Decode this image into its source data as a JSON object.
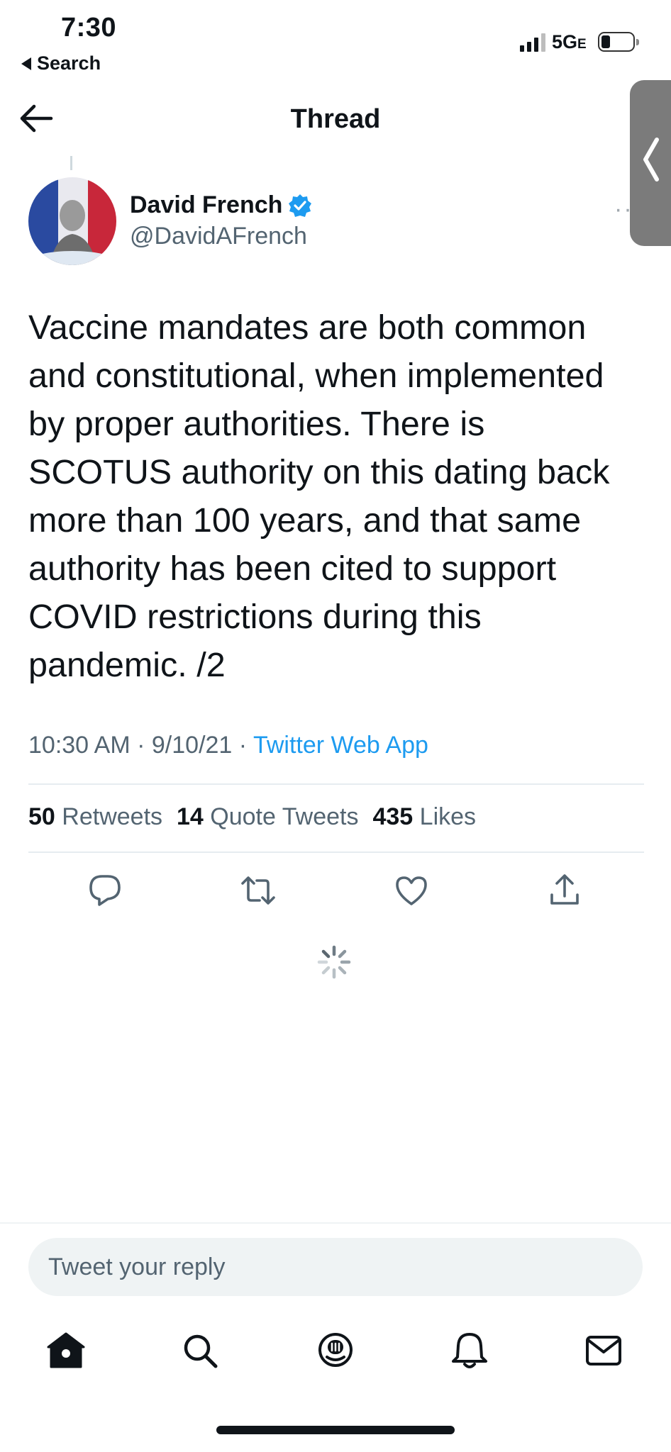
{
  "status_bar": {
    "time": "7:30",
    "back_app_label": "Search",
    "network": "5G",
    "network_suffix": "E"
  },
  "header": {
    "title": "Thread"
  },
  "tweet": {
    "author_name": "David French",
    "author_handle": "@DavidAFrench",
    "verified": true,
    "text": "Vaccine mandates are both common\nand constitutional, when implemented\nby proper authorities. There is\nSCOTUS authority on this dating back\nmore than 100 years, and that same\nauthority has been cited to support\nCOVID restrictions during this\npandemic. /2",
    "time": "10:30 AM",
    "date": "9/10/21",
    "source": "Twitter Web App",
    "stats": {
      "retweets_count": "50",
      "retweets_label": "Retweets",
      "quote_tweets_count": "14",
      "quote_tweets_label": "Quote Tweets",
      "likes_count": "435",
      "likes_label": "Likes"
    }
  },
  "reply": {
    "placeholder": "Tweet your reply"
  },
  "icons": {
    "nav": [
      "home-icon",
      "search-icon",
      "spaces-icon",
      "notifications-icon",
      "messages-icon"
    ],
    "actions": [
      "reply-icon",
      "retweet-icon",
      "like-icon",
      "share-icon"
    ]
  },
  "colors": {
    "accent": "#1d9bf0",
    "text_primary": "#0f1419",
    "text_secondary": "#536471"
  }
}
